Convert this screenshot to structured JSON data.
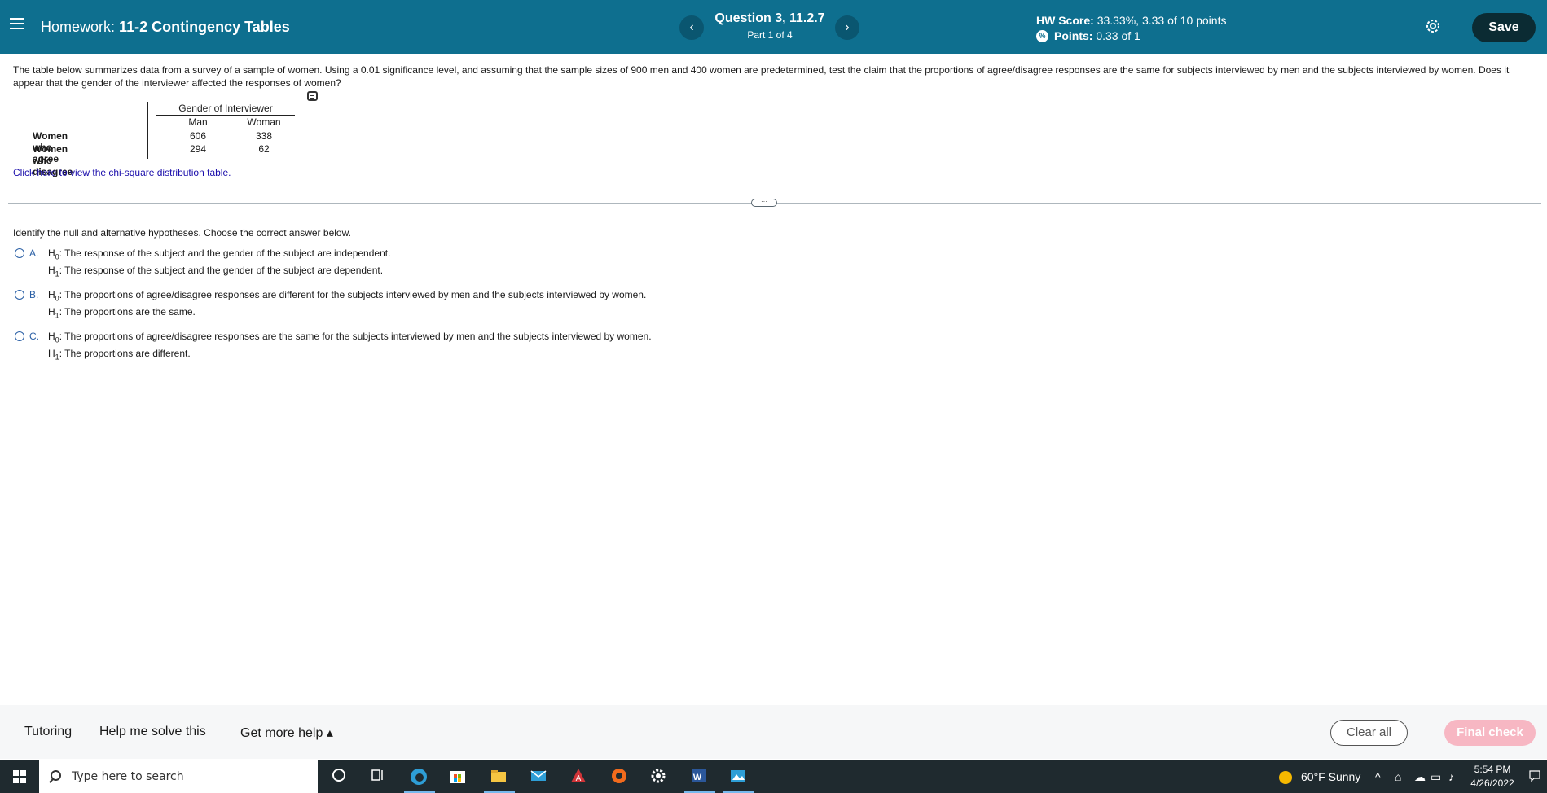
{
  "header": {
    "hw_prefix": "Homework:",
    "hw_name": "11-2 Contingency Tables",
    "question_title": "Question 3, 11.2.7",
    "question_part": "Part 1 of 4",
    "score_label": "HW Score:",
    "score_value": "33.33%, 3.33 of 10 points",
    "points_label": "Points:",
    "points_value": "0.33 of 1",
    "save_label": "Save",
    "prev_glyph": "‹",
    "next_glyph": "›"
  },
  "question": {
    "text": "The table below summarizes data from a survey of a sample of women. Using a 0.01 significance level, and assuming that the sample sizes of 900 men and 400 women are predetermined, test the claim that the proportions of agree/disagree responses are the same for subjects interviewed by men and the subjects interviewed by women. Does it appear that the gender of the interviewer affected the responses of women?",
    "table": {
      "group_header": "Gender of Interviewer",
      "columns": [
        "Man",
        "Woman"
      ],
      "rows": [
        {
          "label": "Women who agree",
          "values": [
            "606",
            "338"
          ]
        },
        {
          "label": "Women who disagree",
          "values": [
            "294",
            "62"
          ]
        }
      ]
    },
    "chi_link": "Click here to view the chi-square distribution table."
  },
  "answer": {
    "instruction": "Identify the null and alternative hypotheses. Choose the correct answer below.",
    "options": [
      {
        "letter": "A.",
        "h0": "The response of the subject and the gender of the subject are independent.",
        "h1": "The response of the subject and the gender of the subject are dependent."
      },
      {
        "letter": "B.",
        "h0": "The proportions of agree/disagree responses are different for the subjects interviewed by men and the subjects interviewed by women.",
        "h1": "The proportions are the same."
      },
      {
        "letter": "C.",
        "h0": "The proportions of agree/disagree responses are the same for the subjects interviewed by men and the subjects interviewed by women.",
        "h1": "The proportions are different."
      }
    ],
    "h_label": "H",
    "h0_sub": "0",
    "h1_sub": "1"
  },
  "footer": {
    "tutoring": "Tutoring",
    "help_solve": "Help me solve this",
    "more_help": "Get more help ▴",
    "clear_all": "Clear all",
    "final_check": "Final check"
  },
  "taskbar": {
    "search_placeholder": "Type here to search",
    "weather": "60°F  Sunny",
    "time": "5:54 PM",
    "date": "4/26/2022"
  },
  "colors": {
    "header_bg": "#0e6f8f",
    "save_bg": "#0b2b33",
    "final_check_bg": "#f7b7c3",
    "link": "#1a0dab",
    "option_letter": "#2a5fa5"
  }
}
